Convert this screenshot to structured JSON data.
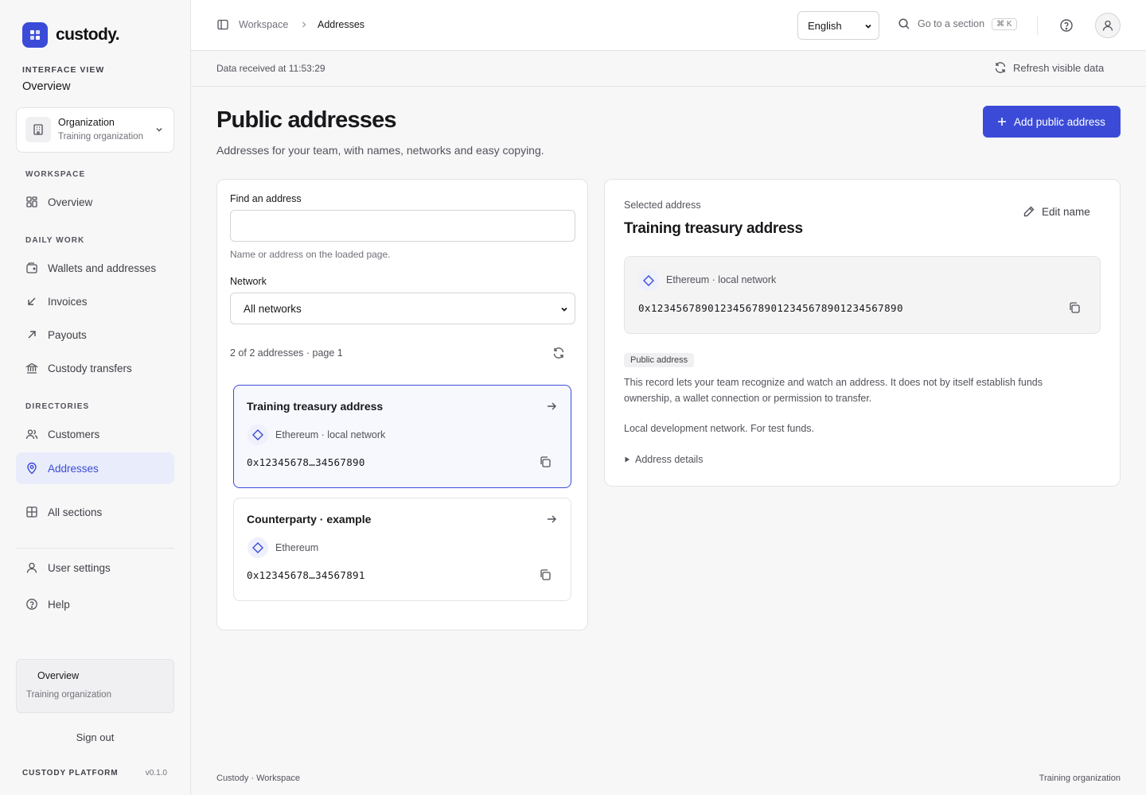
{
  "brand": {
    "name": "custody."
  },
  "sidebar": {
    "interface_view_label": "INTERFACE VIEW",
    "interface_view_value": "Overview",
    "org": {
      "title": "Organization",
      "subtitle": "Training organization"
    },
    "sections": {
      "workspace": "WORKSPACE",
      "daily_work": "DAILY WORK",
      "directories": "DIRECTORIES"
    },
    "items": {
      "overview": "Overview",
      "wallets": "Wallets and addresses",
      "invoices": "Invoices",
      "payouts": "Payouts",
      "custody_transfers": "Custody transfers",
      "customers": "Customers",
      "addresses": "Addresses",
      "all_sections": "All sections",
      "user_settings": "User settings",
      "help": "Help"
    },
    "active_item": "addresses",
    "footer_box": {
      "title": "Overview",
      "subtitle": "Training organization"
    },
    "sign_out": "Sign out",
    "platform": "CUSTODY PLATFORM",
    "version": "v0.1.0"
  },
  "topbar": {
    "breadcrumb": [
      "Workspace",
      "Addresses"
    ],
    "language": "English",
    "goto_label": "Go to a section",
    "goto_shortcut": "⌘ K"
  },
  "subbar": {
    "received": "Data received at 11:53:29",
    "refresh_label": "Refresh visible data"
  },
  "header": {
    "title": "Public addresses",
    "subtitle": "Addresses for your team, with names, networks and easy copying.",
    "add_button": "Add public address"
  },
  "filters": {
    "find_label": "Find an address",
    "find_value": "",
    "find_hint": "Name or address on the loaded page.",
    "network_label": "Network",
    "network_value": "All networks",
    "count_text": "2 of 2 addresses · page 1"
  },
  "addresses": [
    {
      "name": "Training treasury address",
      "network": "Ethereum · local network",
      "short": "0x12345678…34567890",
      "selected": true
    },
    {
      "name": "Counterparty · example",
      "network": "Ethereum",
      "short": "0x12345678…34567891",
      "selected": false
    }
  ],
  "detail": {
    "label": "Selected address",
    "title": "Training treasury address",
    "edit_label": "Edit name",
    "network": "Ethereum · local network",
    "full_address": "0x1234567890123456789012345678901234567890",
    "tag": "Public address",
    "description": "This record lets your team recognize and watch an address. It does not by itself establish funds ownership, a wallet connection or permission to transfer.",
    "note": "Local development network. For test funds.",
    "details_label": "Address details"
  },
  "footer": {
    "left": "Custody · Workspace",
    "right": "Training organization"
  },
  "colors": {
    "accent": "#3b4bd8",
    "accent_soft": "#e9ecfb"
  }
}
